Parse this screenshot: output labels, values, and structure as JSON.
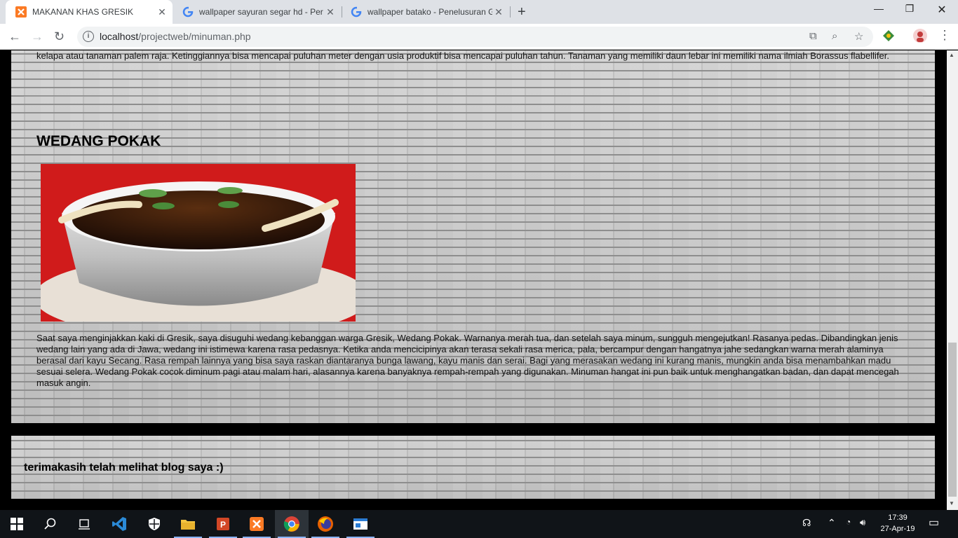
{
  "browser": {
    "tabs": [
      {
        "title": "MAKANAN KHAS GRESIK",
        "active": true,
        "icon": "xampp-icon"
      },
      {
        "title": "wallpaper sayuran segar hd - Per",
        "active": false,
        "icon": "google-icon"
      },
      {
        "title": "wallpaper batako - Penelusuran G",
        "active": false,
        "icon": "google-icon"
      }
    ],
    "url_host": "localhost",
    "url_path": "/projectweb/minuman.php"
  },
  "page": {
    "prev_paragraph": "kelapa atau tanaman palem raja. Ketinggiannya bisa mencapai puluhan meter dengan usia produktif bisa mencapai puluhan tahun. Tanaman yang memiliki daun lebar ini memiliki nama ilmiah Borassus flabellifer.",
    "article_title": "WEDANG POKAK",
    "article_body": "Saat saya menginjakkan kaki di Gresik, saya disuguhi wedang kebanggan warga Gresik, Wedang Pokak. Warnanya merah tua, dan setelah saya minum, sungguh mengejutkan! Rasanya pedas. Dibandingkan jenis wedang lain yang ada di Jawa, wedang ini istimewa karena rasa pedasnya. Ketika anda mencicipinya akan terasa sekali rasa merica, pala, bercampur dengan hangatnya jahe sedangkan warna merah alaminya berasal dari kayu Secang. Rasa rempah lainnya yang bisa saya raskan diantaranya bunga lawang, kayu manis dan serai. Bagi yang merasakan wedang ini kurang manis, mungkin anda bisa menambahkan madu sesuai selera. Wedang Pokak cocok diminum pagi atau malam hari, alasannya karena banyaknya rempah-rempah yang digunakan. Minuman hangat ini pun baik untuk menghangatkan badan, dan dapat mencegah masuk angin.",
    "footer_text": "terimakasih telah melihat blog saya :)"
  },
  "taskbar": {
    "time": "17:39",
    "date": "27-Apr-19"
  },
  "colors": {
    "tab_bar": "#dee1e6",
    "page_background": "#000000",
    "brick": "#c9c9c9"
  }
}
